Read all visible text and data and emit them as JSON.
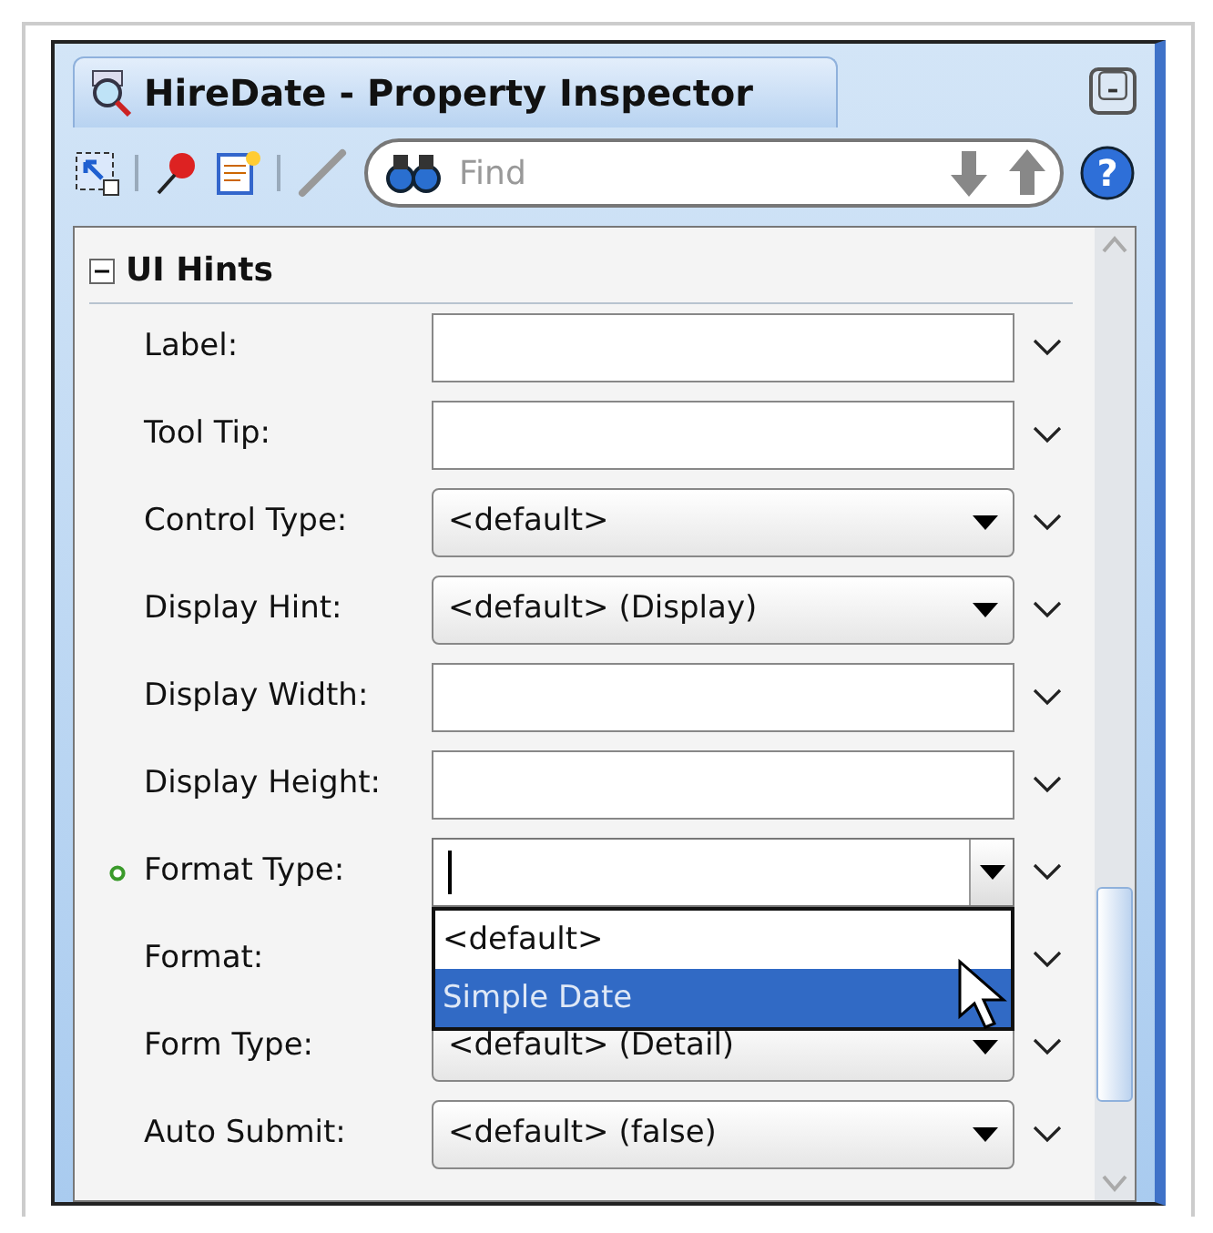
{
  "window": {
    "title": "HireDate - Property Inspector"
  },
  "toolbar": {
    "search": {
      "placeholder": "Find"
    },
    "help": "?"
  },
  "section": {
    "title": "UI Hints",
    "expanded": true
  },
  "rows": [
    {
      "label": "Label:",
      "kind": "text",
      "value": "",
      "modified": false
    },
    {
      "label": "Tool Tip:",
      "kind": "text",
      "value": "",
      "modified": false
    },
    {
      "label": "Control Type:",
      "kind": "select",
      "value": "<default>",
      "modified": false
    },
    {
      "label": "Display Hint:",
      "kind": "select",
      "value": "<default> (Display)",
      "modified": false
    },
    {
      "label": "Display Width:",
      "kind": "text",
      "value": "",
      "modified": false
    },
    {
      "label": "Display Height:",
      "kind": "text",
      "value": "",
      "modified": false
    },
    {
      "label": "Format Type:",
      "kind": "combo",
      "value": "",
      "modified": true,
      "open": true,
      "options": [
        {
          "label": "<default>",
          "selected": false
        },
        {
          "label": "Simple Date",
          "selected": true
        }
      ]
    },
    {
      "label": "Format:",
      "kind": "covered",
      "value": "",
      "modified": false
    },
    {
      "label": "Form Type:",
      "kind": "select",
      "value": "<default> (Detail)",
      "modified": false
    },
    {
      "label": "Auto Submit:",
      "kind": "select",
      "value": "<default> (false)",
      "modified": false
    }
  ]
}
